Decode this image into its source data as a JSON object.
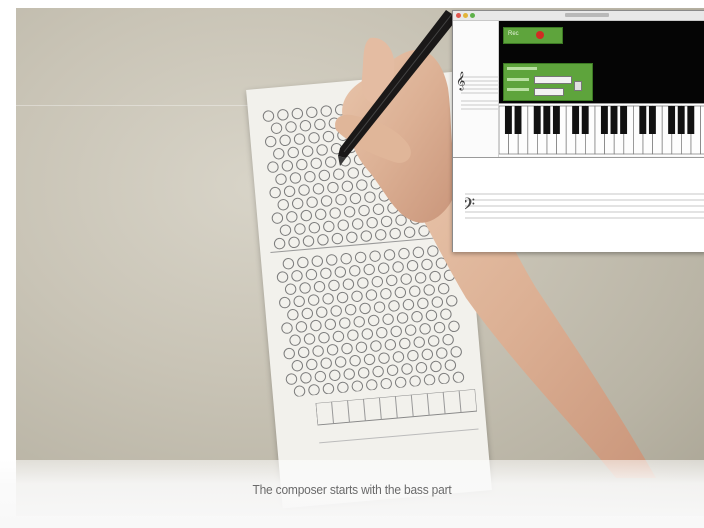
{
  "video": {
    "subtitle": "The composer starts with the bass part"
  },
  "app_window": {
    "record_label": "Rec",
    "clef_icon": "treble-clef-icon",
    "bass_clef_icon": "bass-clef-icon",
    "record_indicator_color": "#d12c23",
    "panel_color": "#5ea43c"
  }
}
